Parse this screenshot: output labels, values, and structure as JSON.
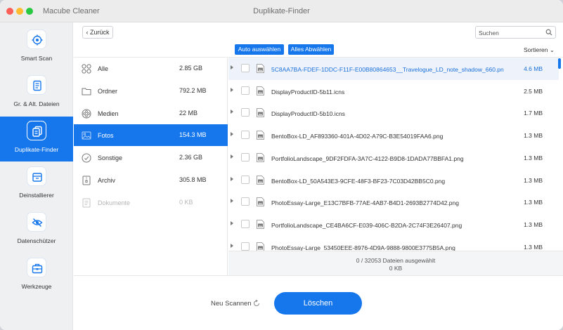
{
  "window": {
    "app_name": "Macube Cleaner",
    "title": "Duplikate-Finder"
  },
  "sidebar": {
    "items": [
      {
        "label": "Smart Scan",
        "icon": "smart-scan-icon"
      },
      {
        "label": "Gr. & Alt. Dateien",
        "icon": "large-old-files-icon"
      },
      {
        "label": "Duplikate-Finder",
        "icon": "duplicate-finder-icon",
        "active": true
      },
      {
        "label": "Deinstallierer",
        "icon": "uninstaller-icon"
      },
      {
        "label": "Datenschützer",
        "icon": "privacy-icon"
      },
      {
        "label": "Werkzeuge",
        "icon": "toolbox-icon"
      }
    ]
  },
  "topbar": {
    "back_label": "Zurück",
    "search_placeholder": "Suchen"
  },
  "categories": [
    {
      "name": "Alle",
      "size": "2.85 GB",
      "icon": "grid-icon"
    },
    {
      "name": "Ordner",
      "size": "792.2 MB",
      "icon": "folder-icon"
    },
    {
      "name": "Medien",
      "size": "22 MB",
      "icon": "media-icon"
    },
    {
      "name": "Fotos",
      "size": "154.3 MB",
      "icon": "photo-icon",
      "active": true
    },
    {
      "name": "Sonstige",
      "size": "2.36 GB",
      "icon": "other-icon"
    },
    {
      "name": "Archiv",
      "size": "305.8 MB",
      "icon": "archive-icon"
    },
    {
      "name": "Dokumente",
      "size": "0 KB",
      "icon": "document-icon",
      "disabled": true
    }
  ],
  "filebar": {
    "auto_select_label": "Auto auswählen",
    "deselect_all_label": "Alles Abwählen",
    "sort_label": "Sortieren"
  },
  "files": [
    {
      "name": "5C8AA7BA-FDEF-1DDC-F11F-E00B80864653__Travelogue_LD_note_shadow_660.pn",
      "size": "4.6 MB",
      "selected": true
    },
    {
      "name": "DisplayProductID-5b11.icns",
      "size": "2.5 MB"
    },
    {
      "name": "DisplayProductID-5b10.icns",
      "size": "1.7 MB"
    },
    {
      "name": "BentoBox-LD_AF893360-401A-4D02-A79C-B3E54019FAA6.png",
      "size": "1.3 MB"
    },
    {
      "name": "PortfolioLandscape_9DF2FDFA-3A7C-4122-B9D8-1DADA77BBFA1.png",
      "size": "1.3 MB"
    },
    {
      "name": "BentoBox-LD_50A543E3-9CFE-48F3-BF23-7C03D42BB5C0.png",
      "size": "1.3 MB"
    },
    {
      "name": "PhotoEssay-Large_E13C7BFB-77AE-4AB7-B4D1-2693B2774D42.png",
      "size": "1.3 MB"
    },
    {
      "name": "PortfolioLandscape_CE4BA6CF-E039-406C-B2DA-2C74F3E26407.png",
      "size": "1.3 MB"
    },
    {
      "name": "PhotoEssay-Large_53450EEE-8976-4D9A-9888-9800E3775B5A.png",
      "size": "1.3 MB"
    }
  ],
  "status": {
    "selected_text": "0 / 32053 Dateien ausgewählt",
    "selected_size": "0 KB"
  },
  "bottom": {
    "rescan_label": "Neu Scannen",
    "delete_label": "Löschen"
  },
  "colors": {
    "accent": "#1677ec"
  }
}
